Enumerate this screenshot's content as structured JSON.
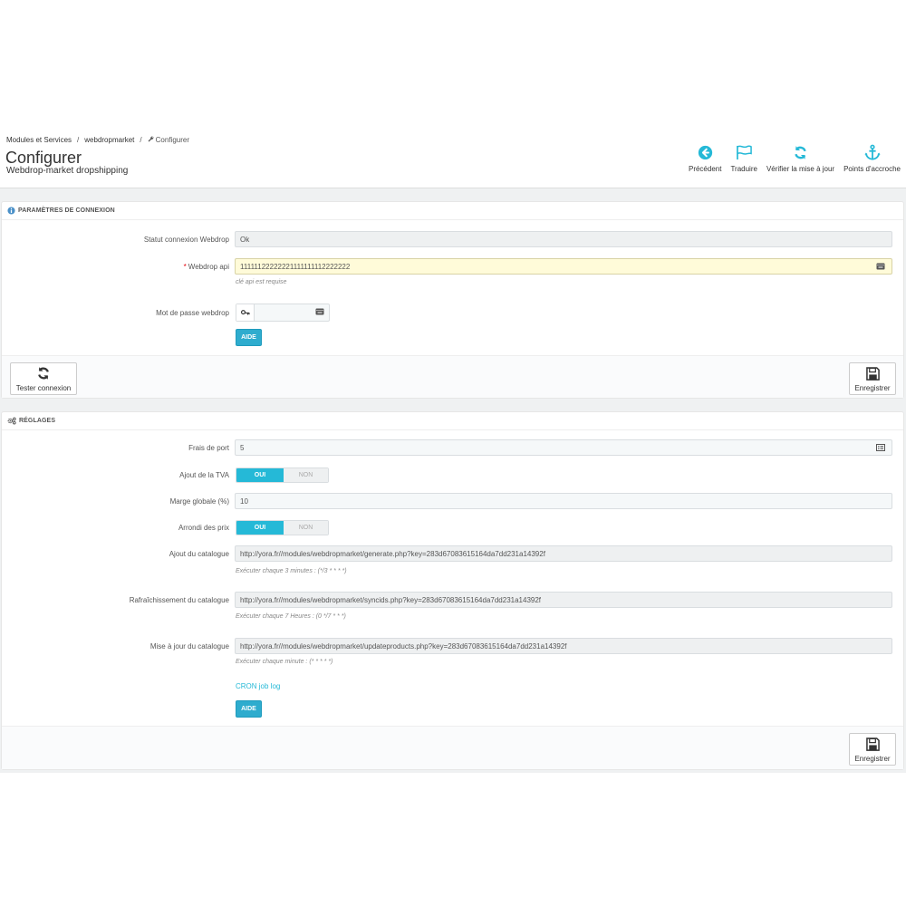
{
  "breadcrumb": {
    "items": [
      "Modules et Services",
      "webdropmarket",
      "Configurer"
    ],
    "separator": "/"
  },
  "page": {
    "title": "Configurer",
    "subtitle": "Webdrop-market dropshipping"
  },
  "toolbar": {
    "back_label": "Précédent",
    "translate_label": "Traduire",
    "update_label": "Vérifier la mise à jour",
    "hooks_label": "Points d'accroche"
  },
  "connection": {
    "heading": "PARAMÈTRES DE CONNEXION",
    "status_label": "Statut connexion Webdrop",
    "status_value": "Ok",
    "api_label": "Webdrop api",
    "api_required_mark": "*",
    "api_value": "11111122222221111111112222222",
    "api_help": "clé api est requise",
    "password_label": "Mot de passe webdrop",
    "password_value": "",
    "help_button": "AIDE",
    "test_button": "Tester connexion",
    "save_button": "Enregistrer"
  },
  "settings": {
    "heading": "RÉGLAGES",
    "shipping_label": "Frais de port",
    "shipping_value": "5",
    "vat_label": "Ajout de la TVA",
    "vat_on": "OUI",
    "vat_off": "NON",
    "margin_label": "Marge globale (%)",
    "margin_value": "10",
    "rounding_label": "Arrondi des prix",
    "rounding_on": "OUI",
    "rounding_off": "NON",
    "catalog_add_label": "Ajout du catalogue",
    "catalog_add_url": "http://yora.fr//modules/webdropmarket/generate.php?key=283d67083615164da7dd231a14392f",
    "catalog_add_help": "Exécuter chaque 3 minutes : (*/3 * * * *)",
    "catalog_refresh_label": "Rafraîchissement du catalogue",
    "catalog_refresh_url": "http://yora.fr//modules/webdropmarket/syncids.php?key=283d67083615164da7dd231a14392f",
    "catalog_refresh_help": "Exécuter chaque 7 Heures : (0 */7 * * *)",
    "catalog_update_label": "Mise à jour du catalogue",
    "catalog_update_url": "http://yora.fr//modules/webdropmarket/updateproducts.php?key=283d67083615164da7dd231a14392f",
    "catalog_update_help": "Exécuter chaque minute : (* * * * *)",
    "cron_link": "CRON job log",
    "help_button": "AIDE",
    "save_button": "Enregistrer"
  },
  "colors": {
    "accent": "#25b9d7",
    "required": "#e3000b",
    "highlight_field": "#fffbd9"
  },
  "icons": [
    "back-icon",
    "flag-icon",
    "refresh-icon",
    "anchor-icon",
    "info-icon",
    "cogs-icon",
    "key-icon",
    "keyboard-icon",
    "list-icon",
    "save-icon",
    "refresh-icon"
  ]
}
